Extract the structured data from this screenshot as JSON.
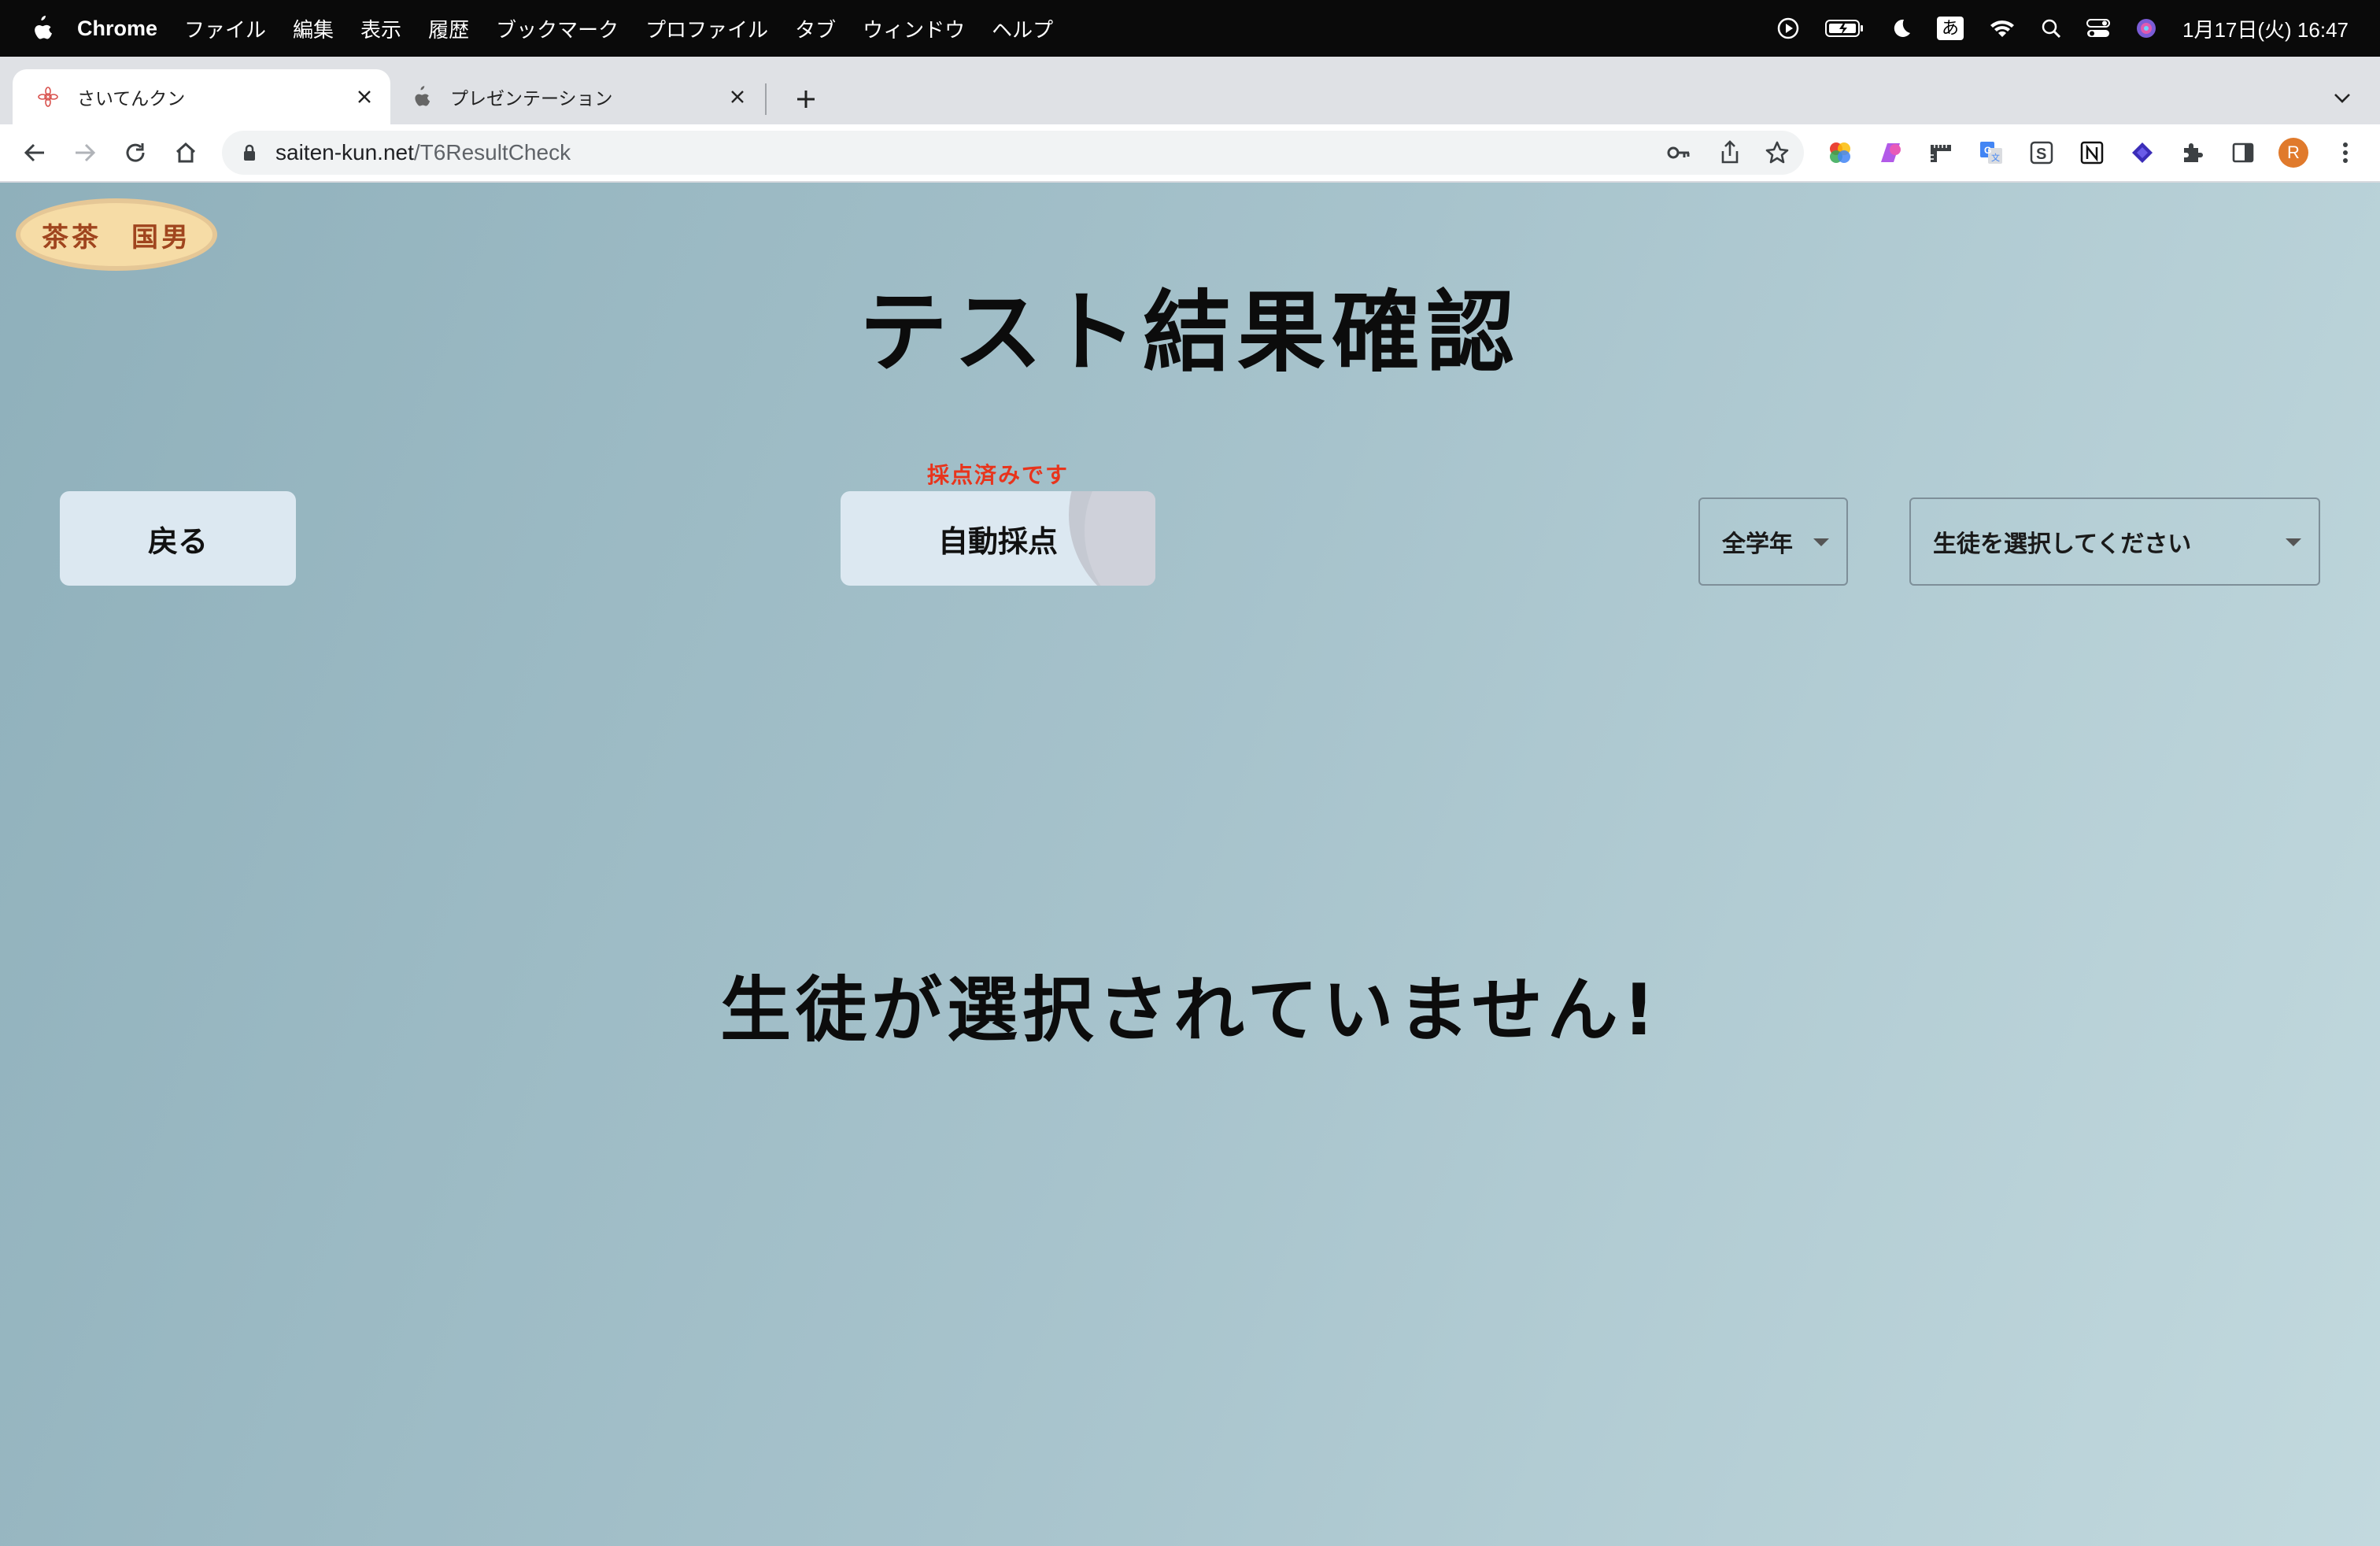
{
  "menubar": {
    "app_name": "Chrome",
    "menus": [
      "ファイル",
      "編集",
      "表示",
      "履歴",
      "ブックマーク",
      "プロファイル",
      "タブ",
      "ウィンドウ",
      "ヘルプ"
    ],
    "ime_indicator": "あ",
    "clock": "1月17日(火) 16:47"
  },
  "tabs": [
    {
      "title": "さいてんクン",
      "active": true,
      "favicon": "saiten-favicon"
    },
    {
      "title": "プレゼンテーション",
      "active": false,
      "favicon": "apple-favicon"
    }
  ],
  "toolbar": {
    "url_host": "saiten-kun.net",
    "url_path": "/T6ResultCheck",
    "profile_initial": "R"
  },
  "page": {
    "user_badge": "茶茶　国男",
    "title": "テスト結果確認",
    "back_label": "戻る",
    "auto_grade_label": "自動採点",
    "graded_note": "採点済みです",
    "grade_filter": "全学年",
    "student_select": "生徒を選択してください",
    "empty_message": "生徒が選択されていません!"
  },
  "colors": {
    "accent_red": "#e8341c",
    "button_bg": "#dce8f1",
    "badge_bg": "#f6dca6",
    "badge_text": "#a0451e"
  }
}
